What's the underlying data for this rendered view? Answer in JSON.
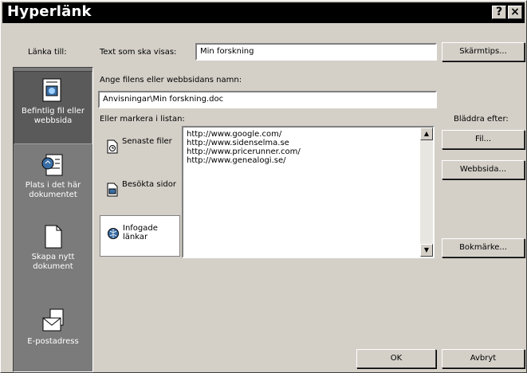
{
  "window": {
    "title": "Hyperlänk",
    "help_glyph": "?",
    "close_glyph": "×"
  },
  "link_to_label": "Länka till:",
  "sidebar": {
    "items": [
      {
        "label": "Befintlig fil eller webbsida",
        "icon": "existing-file-icon",
        "selected": true
      },
      {
        "label": "Plats i det här dokumentet",
        "icon": "place-in-document-icon",
        "selected": false
      },
      {
        "label": "Skapa nytt dokument",
        "icon": "new-document-icon",
        "selected": false
      },
      {
        "label": "E-postadress",
        "icon": "email-icon",
        "selected": false
      }
    ]
  },
  "text_to_display": {
    "label": "Text som ska visas:",
    "value": "Min forskning"
  },
  "screentip_button": "Skärmtips...",
  "filename": {
    "label": "Ange filens eller webbsidans namn:",
    "value": "Anvisningar\\Min forskning.doc"
  },
  "list_label": "Eller markera i listan:",
  "browse_label": "Bläddra efter:",
  "categories": [
    {
      "label": "Senaste filer",
      "icon": "recent-files-icon",
      "selected": false
    },
    {
      "label": "Besökta sidor",
      "icon": "visited-pages-icon",
      "selected": false
    },
    {
      "label": "Infogade länkar",
      "icon": "inserted-links-icon",
      "selected": true
    }
  ],
  "links": [
    "http://www.google.com/",
    "http://www.sidenselma.se",
    "http://www.pricerunner.com/",
    "http://www.genealogi.se/"
  ],
  "buttons": {
    "file": "Fil...",
    "webpage": "Webbsida...",
    "bookmark": "Bokmärke...",
    "ok": "OK",
    "cancel": "Avbryt"
  },
  "colors": {
    "title_bar": "#000000",
    "dialog_bg": "#d4d0c8",
    "sidebar_bg": "#7b7b7b"
  }
}
